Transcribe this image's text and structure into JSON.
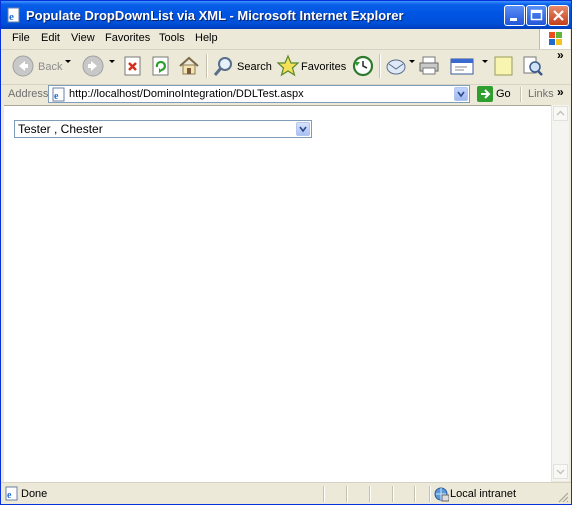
{
  "window": {
    "title": "Populate DropDownList via XML - Microsoft Internet Explorer"
  },
  "menu": {
    "items": [
      "File",
      "Edit",
      "View",
      "Favorites",
      "Tools",
      "Help"
    ]
  },
  "toolbar": {
    "back_label": "Back",
    "search_label": "Search",
    "favorites_label": "Favorites",
    "overflow": "»"
  },
  "address": {
    "label": "Address",
    "url": "http://localhost/DominoIntegration/DDLTest.aspx",
    "go_label": "Go",
    "links_label": "Links",
    "links_overflow": "»"
  },
  "page": {
    "dropdown": {
      "selected": "Tester , Chester"
    }
  },
  "status": {
    "text": "Done",
    "zone": "Local intranet"
  },
  "colors": {
    "titlebar": "#0054e3",
    "chrome": "#ece9d8",
    "border": "#7f9db9"
  }
}
